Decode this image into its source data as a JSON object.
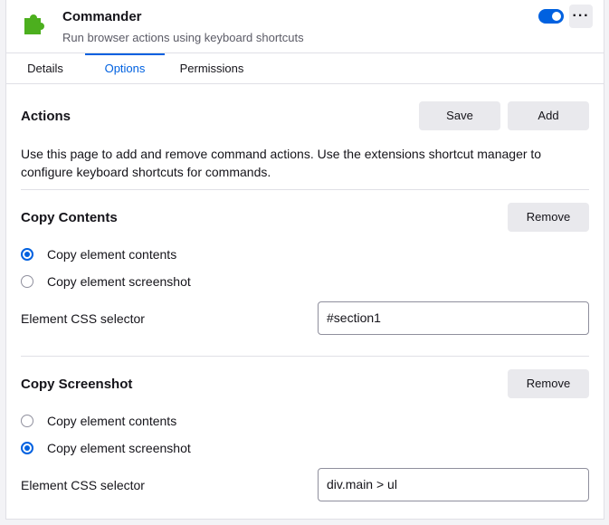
{
  "addon": {
    "name": "Commander",
    "description": "Run browser actions using keyboard shortcuts",
    "icon": "puzzle-piece-icon",
    "enabled": true,
    "accent_color": "#0061e0",
    "icon_color": "#4caf1e"
  },
  "tabs": [
    {
      "label": "Details",
      "active": false
    },
    {
      "label": "Options",
      "active": true
    },
    {
      "label": "Permissions",
      "active": false
    }
  ],
  "actions": {
    "title": "Actions",
    "save_label": "Save",
    "add_label": "Add",
    "description": "Use this page to add and remove command actions. Use the extensions shortcut manager to configure keyboard shortcuts for commands."
  },
  "commands": [
    {
      "title": "Copy Contents",
      "remove_label": "Remove",
      "options": [
        {
          "label": "Copy element contents",
          "checked": true
        },
        {
          "label": "Copy element screenshot",
          "checked": false
        }
      ],
      "selector_label": "Element CSS selector",
      "selector_value": "#section1"
    },
    {
      "title": "Copy Screenshot",
      "remove_label": "Remove",
      "options": [
        {
          "label": "Copy element contents",
          "checked": false
        },
        {
          "label": "Copy element screenshot",
          "checked": true
        }
      ],
      "selector_label": "Element CSS selector",
      "selector_value": "div.main > ul"
    }
  ]
}
